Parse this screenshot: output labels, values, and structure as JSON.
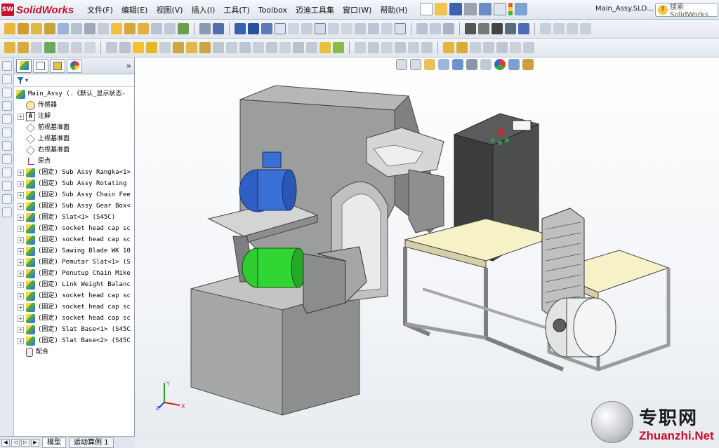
{
  "app": {
    "name": "SolidWorks",
    "logo_badge": "SW"
  },
  "menu": [
    "文件(F)",
    "编辑(E)",
    "视图(V)",
    "插入(I)",
    "工具(T)",
    "Toolbox",
    "迈迪工具集",
    "窗口(W)",
    "帮助(H)"
  ],
  "document_title": "Main_Assy.SLD...",
  "search": {
    "value": "搜索 SolidWorks"
  },
  "feature_tree": {
    "root": "Main_Assy   (.《默认_显示状态-",
    "items": [
      {
        "label": "传感器",
        "icon": "sensor-icon",
        "expandable": false
      },
      {
        "label": "注解",
        "icon": "annotation-icon",
        "expandable": true
      },
      {
        "label": "前视基准面",
        "icon": "plane-icon",
        "expandable": false
      },
      {
        "label": "上视基准面",
        "icon": "plane-icon",
        "expandable": false
      },
      {
        "label": "右视基准面",
        "icon": "plane-icon",
        "expandable": false
      },
      {
        "label": "原点",
        "icon": "origin-icon",
        "expandable": false
      },
      {
        "label": "(固定) Sub Assy Rangka<1>",
        "icon": "subassembly-icon",
        "expandable": true
      },
      {
        "label": "(固定) Sub Assy Rotating",
        "icon": "subassembly-icon",
        "expandable": true
      },
      {
        "label": "(固定) Sub Assy Chain Fee",
        "icon": "subassembly-icon",
        "expandable": true
      },
      {
        "label": "(固定) Sub Assy Gear Box<",
        "icon": "subassembly-icon",
        "expandable": true
      },
      {
        "label": "(固定) Slat<1> (S45C)",
        "icon": "part-icon",
        "expandable": true
      },
      {
        "label": "(固定) socket head cap sc",
        "icon": "part-icon",
        "expandable": true
      },
      {
        "label": "(固定) socket head cap sc",
        "icon": "part-icon",
        "expandable": true
      },
      {
        "label": "(固定) Sawing Blade WK 10",
        "icon": "part-icon",
        "expandable": true
      },
      {
        "label": "(固定) Pemutar Slat<1> (S",
        "icon": "part-icon",
        "expandable": true
      },
      {
        "label": "(固定) Penutup Chain Mike",
        "icon": "part-icon",
        "expandable": true
      },
      {
        "label": "(固定) Link Weight Balanc",
        "icon": "part-icon",
        "expandable": true
      },
      {
        "label": "(固定) socket head cap sc",
        "icon": "part-icon",
        "expandable": true
      },
      {
        "label": "(固定) socket head cap sc",
        "icon": "part-icon",
        "expandable": true
      },
      {
        "label": "(固定) socket head cap sc",
        "icon": "part-icon",
        "expandable": true
      },
      {
        "label": "(固定) Slat Base<1> (S45C",
        "icon": "part-icon",
        "expandable": true
      },
      {
        "label": "(固定) Slat Base<2> (S45C",
        "icon": "part-icon",
        "expandable": true
      },
      {
        "label": "配合",
        "icon": "mates-icon",
        "expandable": false
      }
    ]
  },
  "bottom_tabs": [
    "模型",
    "运动算例 1"
  ],
  "triad": {
    "x": "X",
    "y": "Y",
    "z": "Z"
  },
  "watermark": {
    "cn": "专职网",
    "en": "Zhuanzhi.Net"
  },
  "colors": {
    "brand": "#c8102e",
    "motor_blue": "#2f5fc4",
    "motor_green": "#2ecc2e",
    "machine_gray": "#9a9c9b",
    "table_cream": "#f7f1c8"
  }
}
